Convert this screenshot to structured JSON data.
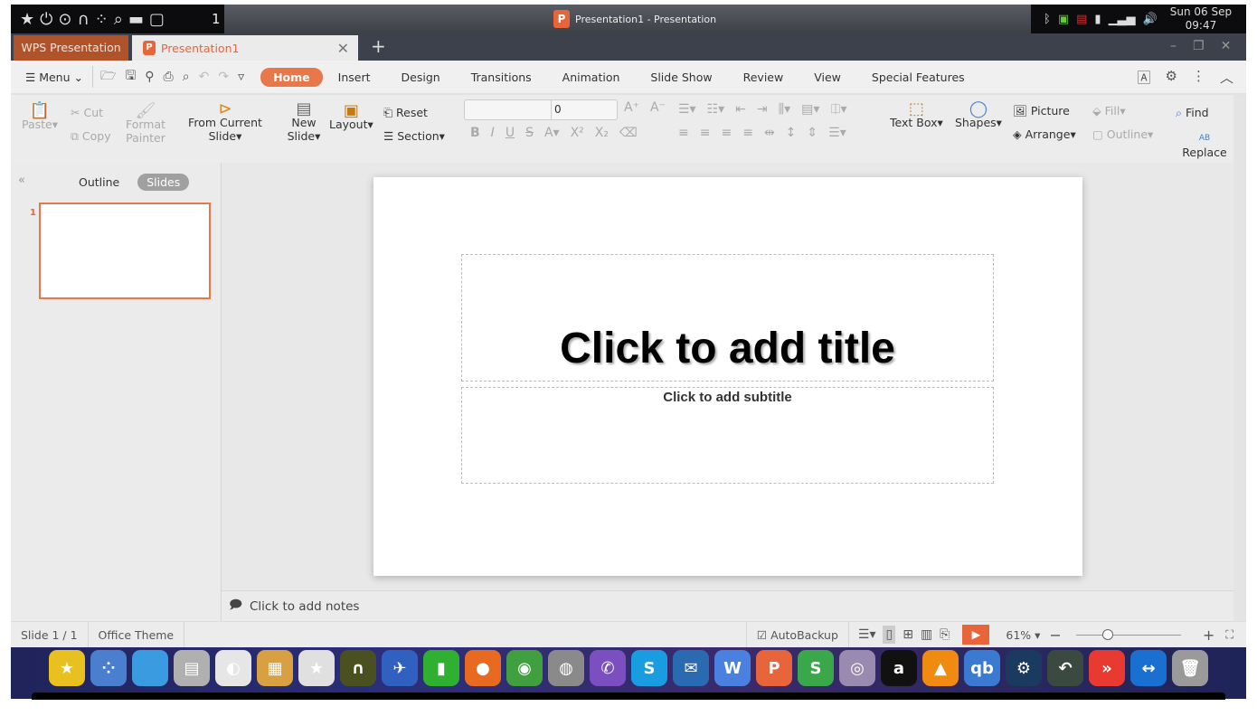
{
  "system": {
    "workspace": "1",
    "window_title": "Presentation1 - Presentation",
    "clock_day": "Sun 06 Sep",
    "clock_time": "09:47",
    "tray_icons": [
      "bluetooth-icon",
      "battery-icon",
      "us-flag-icon",
      "usb-icon",
      "signal-icon",
      "volume-icon"
    ],
    "launcher_icons": [
      "star-icon",
      "power-icon",
      "toggle-icon",
      "binoculars-icon",
      "apps-icon",
      "search-icon",
      "folder-icon",
      "tablet-icon"
    ]
  },
  "tabs": {
    "home_tab": "WPS Presentation",
    "doc_tab": "Presentation1",
    "new_tab": "+"
  },
  "menu": {
    "menu_label": "Menu",
    "ribbon_tabs": [
      "Home",
      "Insert",
      "Design",
      "Transitions",
      "Animation",
      "Slide Show",
      "Review",
      "View",
      "Special Features"
    ],
    "active_tab": "Home"
  },
  "toolbar": {
    "paste": "Paste",
    "cut": "Cut",
    "copy": "Copy",
    "format_painter": "Format Painter",
    "from_current_slide": "From Current Slide",
    "new_slide": "New Slide",
    "layout": "Layout",
    "reset": "Reset",
    "section": "Section",
    "font_name": "",
    "font_size": "0",
    "text_box": "Text Box",
    "shapes": "Shapes",
    "picture": "Picture",
    "arrange": "Arrange",
    "fill": "Fill",
    "outline": "Outline",
    "find": "Find",
    "replace": "Replace"
  },
  "left_panel": {
    "outline_tab": "Outline",
    "slides_tab": "Slides",
    "active": "Slides",
    "slide_numbers": [
      "1"
    ]
  },
  "slide": {
    "title_placeholder": "Click to add title",
    "subtitle_placeholder": "Click to add subtitle"
  },
  "notes": {
    "placeholder": "Click to add notes"
  },
  "status": {
    "slide_counter": "Slide 1 / 1",
    "theme": "Office Theme",
    "autobackup": "AutoBackup",
    "zoom": "61%",
    "zoom_fraction": 0.3
  },
  "dock": {
    "items": [
      {
        "name": "kstars",
        "color": "#e8c020",
        "glyph": "★"
      },
      {
        "name": "launcher",
        "color": "#4a7fd0",
        "glyph": "⁘"
      },
      {
        "name": "finder",
        "color": "#3a9be0",
        "glyph": ""
      },
      {
        "name": "cabinet",
        "color": "#b0b0b0",
        "glyph": "▤"
      },
      {
        "name": "settings",
        "color": "#e6e6e6",
        "glyph": "◐"
      },
      {
        "name": "palette",
        "color": "#d8a040",
        "glyph": "▦"
      },
      {
        "name": "app-store",
        "color": "#e0e0e0",
        "glyph": "★"
      },
      {
        "name": "binoculars",
        "color": "#4a5020",
        "glyph": "∩"
      },
      {
        "name": "rocket",
        "color": "#3060c0",
        "glyph": "✈"
      },
      {
        "name": "pipe",
        "color": "#30b030",
        "glyph": "▮"
      },
      {
        "name": "firefox",
        "color": "#e86a20",
        "glyph": "●"
      },
      {
        "name": "chrome",
        "color": "#40a040",
        "glyph": "◉"
      },
      {
        "name": "earth-pro",
        "color": "#8a8a8a",
        "glyph": "◍"
      },
      {
        "name": "viber",
        "color": "#7b4fc0",
        "glyph": "✆"
      },
      {
        "name": "skype",
        "color": "#1a9de0",
        "glyph": "S"
      },
      {
        "name": "thunderbird",
        "color": "#2a6ab0",
        "glyph": "✉"
      },
      {
        "name": "wps-writer",
        "color": "#4a80e0",
        "glyph": "W"
      },
      {
        "name": "wps-presentation",
        "color": "#e8643a",
        "glyph": "P"
      },
      {
        "name": "wps-spreadsheet",
        "color": "#3aa84a",
        "glyph": "S"
      },
      {
        "name": "webcam",
        "color": "#9a8ab0",
        "glyph": "◎"
      },
      {
        "name": "amazon",
        "color": "#111",
        "glyph": "a"
      },
      {
        "name": "vlc",
        "color": "#f08a10",
        "glyph": "▲"
      },
      {
        "name": "qbittorrent",
        "color": "#3a7ad0",
        "glyph": "qb"
      },
      {
        "name": "steam",
        "color": "#1a3a60",
        "glyph": "⚙"
      },
      {
        "name": "timeshift",
        "color": "#3a4a40",
        "glyph": "↶"
      },
      {
        "name": "anydesk",
        "color": "#e83a30",
        "glyph": "»"
      },
      {
        "name": "teamviewer",
        "color": "#1a70d0",
        "glyph": "↔"
      },
      {
        "name": "trash",
        "color": "#9a9a9a",
        "glyph": "🗑"
      }
    ]
  },
  "colors": {
    "accent": "#e8643a",
    "tab_home_bg": "#b1532a"
  }
}
